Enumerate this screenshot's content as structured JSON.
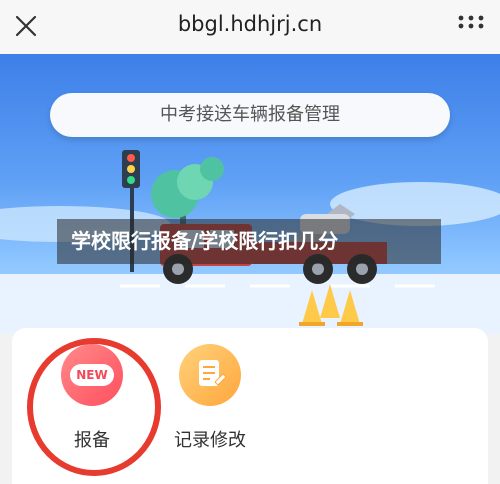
{
  "browser": {
    "url": "bbgl.hdhjrj.cn",
    "close_icon": "close-icon",
    "more_icon": "more-vertical-icon"
  },
  "banner": {
    "title": "中考接送车辆报备管理"
  },
  "overlay": {
    "caption": "学校限行报备/学校限行扣几分"
  },
  "menu": {
    "items": [
      {
        "label": "报备",
        "badge": "NEW",
        "icon": "new-badge-icon",
        "color": "#ff5a6a"
      },
      {
        "label": "记录修改",
        "icon": "document-edit-icon",
        "color": "#ffb347"
      }
    ]
  },
  "colors": {
    "sky": "#5fa0f5",
    "annotation_ring": "#e63b2e"
  }
}
